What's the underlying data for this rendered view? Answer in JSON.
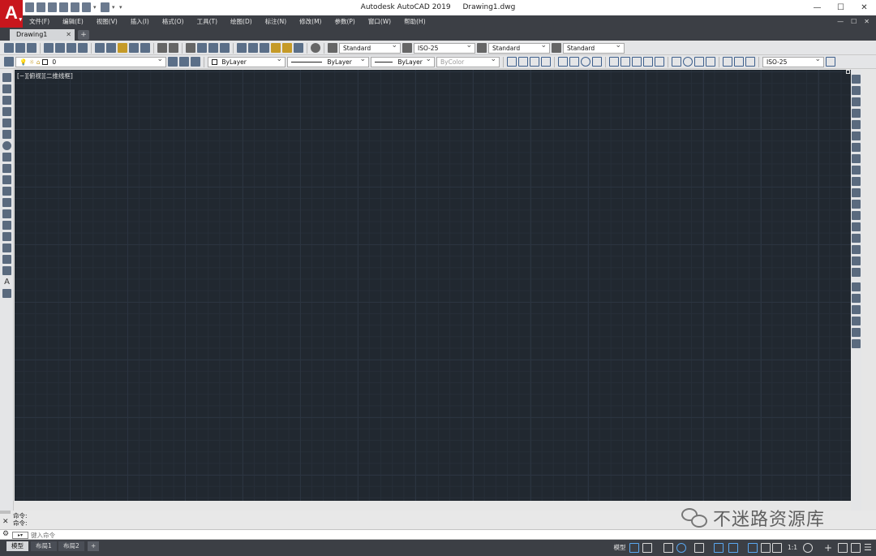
{
  "titlebar": {
    "app_logo": "A",
    "app_name": "Autodesk AutoCAD 2019",
    "document": "Drawing1.dwg",
    "minimize": "—",
    "maximize": "☐",
    "close": "✕"
  },
  "menu": {
    "items": [
      "文件(F)",
      "编辑(E)",
      "视图(V)",
      "插入(I)",
      "格式(O)",
      "工具(T)",
      "绘图(D)",
      "标注(N)",
      "修改(M)",
      "参数(P)",
      "窗口(W)",
      "帮助(H)"
    ],
    "right": [
      "—",
      "☐",
      "✕"
    ]
  },
  "tabs": {
    "document_tab": "Drawing1",
    "close_glyph": "✕",
    "add_glyph": "+"
  },
  "toolbar1": {
    "text_style": "Standard",
    "dim_style": "ISO-25",
    "table_style": "Standard",
    "mleader_style": "Standard"
  },
  "toolbar2": {
    "layer": "0",
    "color": "ByLayer",
    "linetype": "ByLayer",
    "lineweight": "ByLayer",
    "plot_style": "ByColor",
    "dim_style": "ISO-25"
  },
  "canvas": {
    "viewport_label": "[−][俯视][二维线框]",
    "background": "#212830"
  },
  "command": {
    "history": [
      "命令:",
      "命令:"
    ],
    "placeholder": "键入命令",
    "close_glyph": "✕",
    "wrench_glyph": "🔧"
  },
  "layout_tabs": [
    "模型",
    "布局1",
    "布局2"
  ],
  "layout_add": "+",
  "status": {
    "model": "模型",
    "scale": "1:1"
  },
  "watermark": {
    "text": "不迷路资源库"
  }
}
